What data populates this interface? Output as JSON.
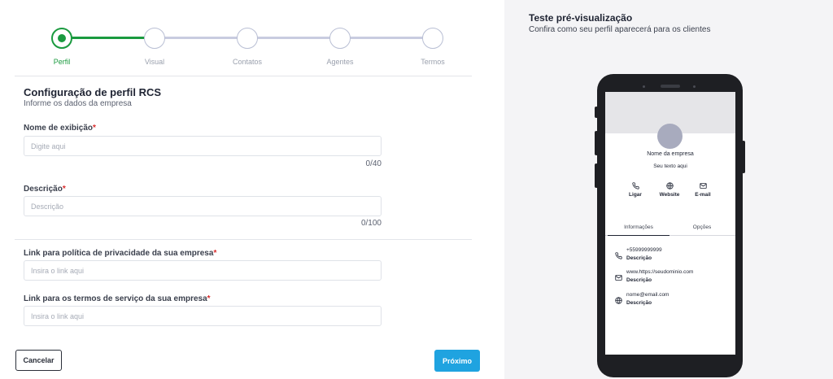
{
  "steps": [
    {
      "label": "Perfil",
      "active": true
    },
    {
      "label": "Visual",
      "active": false
    },
    {
      "label": "Contatos",
      "active": false
    },
    {
      "label": "Agentes",
      "active": false
    },
    {
      "label": "Termos",
      "active": false
    }
  ],
  "colors": {
    "accent": "#1a9a3f",
    "primary_button": "#1fa3e0",
    "required": "#d92b2b"
  },
  "form": {
    "title": "Configuração de perfil RCS",
    "subtitle": "Informe os dados da empresa",
    "display_name": {
      "label": "Nome de exibição",
      "required_mark": "*",
      "placeholder": "Digite aqui",
      "value": "",
      "counter": "0/40"
    },
    "description": {
      "label": "Descrição",
      "required_mark": "*",
      "placeholder": "Descrição",
      "value": "",
      "counter": "0/100"
    },
    "privacy_link": {
      "label": "Link para política de privacidade da sua empresa",
      "required_mark": "*",
      "placeholder": "Insira o link aqui",
      "value": ""
    },
    "terms_link": {
      "label": "Link para os termos de serviço da sua empresa",
      "required_mark": "*",
      "placeholder": "Insira o link aqui",
      "value": ""
    }
  },
  "buttons": {
    "cancel": "Cancelar",
    "next": "Próximo"
  },
  "preview": {
    "title": "Teste pré-visualização",
    "subtitle": "Confira como seu perfil aparecerá para os clientes",
    "company_name": "Nome da empresa",
    "tagline": "Seu texto aqui",
    "actions": [
      {
        "label": "Ligar",
        "icon": "phone-icon"
      },
      {
        "label": "Website",
        "icon": "globe-icon"
      },
      {
        "label": "E-mail",
        "icon": "mail-icon"
      }
    ],
    "tabs": [
      "Informações",
      "Opções"
    ],
    "active_tab": "Informações",
    "info": [
      {
        "value": "+55999999999",
        "desc": "Descrição",
        "icon": "phone-icon"
      },
      {
        "value": "www.https://seudominio.com",
        "desc": "Descrição",
        "icon": "mail-icon"
      },
      {
        "value": "nome@email.com",
        "desc": "Descrição",
        "icon": "globe-icon"
      }
    ]
  }
}
